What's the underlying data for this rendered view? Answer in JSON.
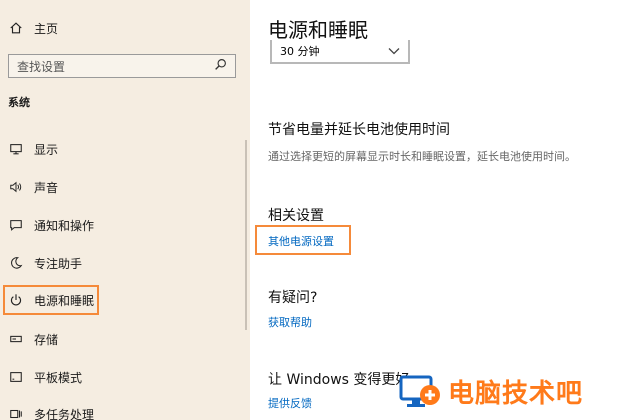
{
  "sidebar": {
    "home_label": "主页",
    "search_placeholder": "查找设置",
    "section_label": "系统",
    "items": [
      {
        "label": "显示",
        "icon": "monitor-icon"
      },
      {
        "label": "声音",
        "icon": "speaker-icon"
      },
      {
        "label": "通知和操作",
        "icon": "notification-icon"
      },
      {
        "label": "专注助手",
        "icon": "moon-icon"
      },
      {
        "label": "电源和睡眠",
        "icon": "power-icon",
        "selected": true
      },
      {
        "label": "存储",
        "icon": "storage-icon"
      },
      {
        "label": "平板模式",
        "icon": "tablet-icon"
      },
      {
        "label": "多任务处理",
        "icon": "multitask-icon"
      }
    ]
  },
  "main": {
    "title": "电源和睡眠",
    "sleep_dropdown_value": "30 分钟",
    "battery_heading": "节省电量并延长电池使用时间",
    "battery_desc": "通过选择更短的屏幕显示时长和睡眠设置，延长电池使用时间。",
    "related_heading": "相关设置",
    "related_link": "其他电源设置",
    "question_heading": "有疑问?",
    "help_link": "获取帮助",
    "improve_heading": "让 Windows 变得更好",
    "feedback_link": "提供反馈"
  },
  "watermark": {
    "text": "电脑技术吧"
  },
  "colors": {
    "sidebar_bg": "#f5ede1",
    "highlight_orange": "#f58a3a",
    "link_blue": "#0067c0"
  }
}
